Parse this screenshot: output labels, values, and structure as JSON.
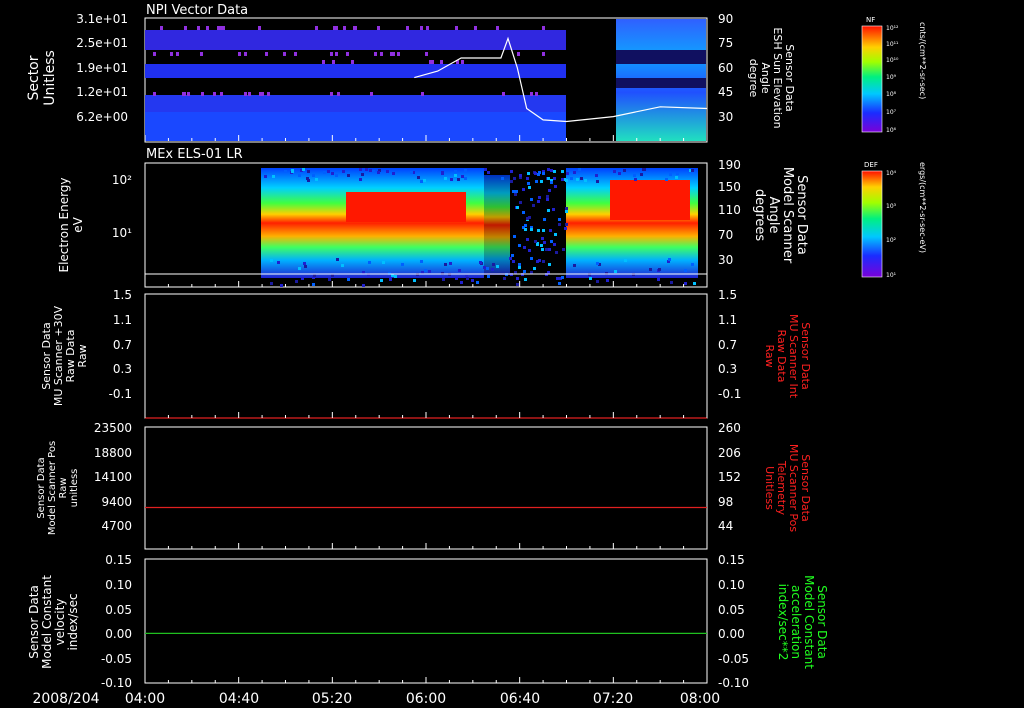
{
  "date_label": "2008/204",
  "time_ticks": [
    "04:00",
    "04:40",
    "05:20",
    "06:00",
    "06:40",
    "07:20",
    "08:00"
  ],
  "chart_data": [
    {
      "type": "heatmap",
      "title": "NPI Vector Data",
      "ylabel_left": [
        "Sector",
        "Unitless"
      ],
      "yticks_left": [
        "3.1e+01",
        "2.5e+01",
        "1.9e+01",
        "1.2e+01",
        "6.2e+00"
      ],
      "ylabel_right": [
        "Sensor Data",
        "ESH Sun Elevation",
        "Angle",
        "degree"
      ],
      "yticks_right": [
        "90",
        "75",
        "60",
        "45",
        "30"
      ],
      "ylim_right": [
        15,
        90
      ],
      "overlay_line": {
        "color": "#ffffff",
        "x": [
          "05:55",
          "06:05",
          "06:15",
          "06:25",
          "06:32",
          "06:35",
          "06:39",
          "06:43",
          "06:50",
          "07:00",
          "07:20",
          "07:40",
          "08:00"
        ],
        "y": [
          54,
          58,
          66,
          66,
          66,
          78,
          60,
          35,
          28,
          27,
          30,
          36,
          35
        ]
      },
      "data_gap": [
        "07:00",
        "07:30"
      ],
      "colorbar": {
        "label": "NF",
        "units": "cnts/(cm**2-sr-sec)",
        "ticks": [
          "10¹²",
          "10¹¹",
          "10¹⁰",
          "10⁹",
          "10⁸",
          "10⁷",
          "10⁶"
        ]
      }
    },
    {
      "type": "heatmap",
      "title": "MEx ELS-01 LR",
      "ylabel_left": [
        "Electron Energy",
        "eV"
      ],
      "yticks_left": [
        "10²",
        "10¹"
      ],
      "scale_left": "log",
      "ylabel_right": [
        "Sensor Data",
        "Model Scanner",
        "Angle",
        "degrees"
      ],
      "yticks_right": [
        "190",
        "150",
        "110",
        "70",
        "30"
      ],
      "ylim_right": [
        0,
        190
      ],
      "data_start": "04:50",
      "colorbar": {
        "label": "DEF",
        "units": "ergs/(cm**2-sr-sec-eV)",
        "ticks": [
          "10⁴",
          "10³",
          "10²",
          "10¹"
        ]
      }
    },
    {
      "type": "line",
      "ylabel_left": [
        "Sensor Data",
        "MU Scanner +30V",
        "Raw Data",
        "Raw"
      ],
      "yticks_left": [
        "1.5",
        "1.1",
        "0.7",
        "0.3",
        "-0.1"
      ],
      "ylim_left": [
        -0.3,
        1.5
      ],
      "ylabel_right": [
        "Sensor Data",
        "MU Scanner Int",
        "Raw Data",
        "Raw"
      ],
      "ylabel_right_color": "#ff2020",
      "yticks_right": [
        "1.5",
        "1.1",
        "0.7",
        "0.3",
        "-0.1"
      ],
      "series": [
        {
          "color": "#e02020",
          "x": [
            "04:00",
            "08:00"
          ],
          "y": [
            -0.3,
            -0.3
          ]
        }
      ]
    },
    {
      "type": "line",
      "ylabel_left": [
        "Sensor Data",
        "Model Scanner Pos",
        "Raw",
        "unitless"
      ],
      "yticks_left": [
        "23500",
        "18800",
        "14100",
        "9400",
        "4700"
      ],
      "ylim_left": [
        0,
        23500
      ],
      "ylabel_right": [
        "Sensor Data",
        "MU Scanner Pos",
        "Telemetry",
        "Unitless"
      ],
      "ylabel_right_color": "#ff2020",
      "yticks_right": [
        "260",
        "206",
        "152",
        "98",
        "44"
      ],
      "series": [
        {
          "color": "#e02020",
          "x": [
            "04:00",
            "08:00"
          ],
          "y": [
            8000,
            8000
          ]
        }
      ]
    },
    {
      "type": "line",
      "ylabel_left": [
        "Sensor Data",
        "Model Constant",
        "velocity",
        "index/sec"
      ],
      "yticks_left": [
        "0.15",
        "0.10",
        "0.05",
        "0.00",
        "-0.05",
        "-0.10"
      ],
      "ylim_left": [
        -0.1,
        0.15
      ],
      "ylabel_right": [
        "Sensor Data",
        "Model Constant",
        "acceleration",
        "index/sec**2"
      ],
      "ylabel_right_color": "#20ff20",
      "yticks_right": [
        "0.15",
        "0.10",
        "0.05",
        "0.00",
        "-0.05",
        "-0.10"
      ],
      "series": [
        {
          "color": "#20c020",
          "x": [
            "04:00",
            "08:00"
          ],
          "y": [
            0.0,
            0.0
          ]
        }
      ]
    }
  ]
}
